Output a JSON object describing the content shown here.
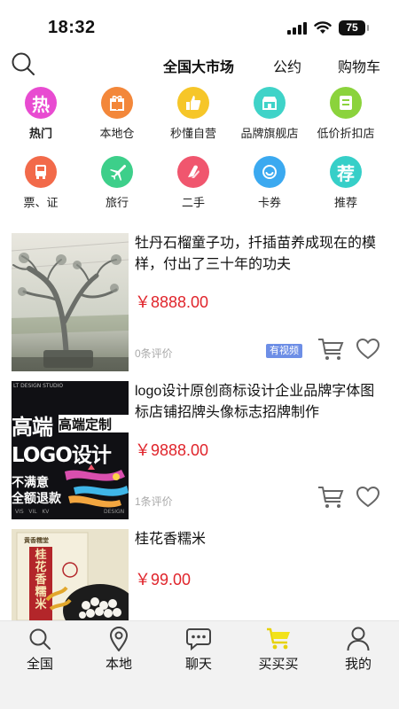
{
  "status_bar": {
    "time": "18:32",
    "battery": "75"
  },
  "top_nav": {
    "tabs": [
      {
        "label": "全国大市场",
        "active": true
      },
      {
        "label": "公约",
        "active": false
      },
      {
        "label": "购物车",
        "active": false
      }
    ]
  },
  "categories": [
    {
      "label": "热门",
      "icon": "hot-icon",
      "glyph": "热",
      "color": "#e84bd1",
      "selected": true
    },
    {
      "label": "本地仓",
      "icon": "gift-icon",
      "glyph": "",
      "color": "#f3873a",
      "selected": false
    },
    {
      "label": "秒懂自营",
      "icon": "thumbs-up-icon",
      "glyph": "",
      "color": "#f6c629",
      "selected": false
    },
    {
      "label": "品牌旗舰店",
      "icon": "store-icon",
      "glyph": "",
      "color": "#3fd3c8",
      "selected": false
    },
    {
      "label": "低价折扣店",
      "icon": "discount-store-icon",
      "glyph": "",
      "color": "#8bd33c",
      "selected": false
    },
    {
      "label": "票、证",
      "icon": "bus-ticket-icon",
      "glyph": "",
      "color": "#f26a4a",
      "selected": false
    },
    {
      "label": "旅行",
      "icon": "airplane-icon",
      "glyph": "",
      "color": "#3dcf8a",
      "selected": false
    },
    {
      "label": "二手",
      "icon": "second-hand-icon",
      "glyph": "",
      "color": "#f0566e",
      "selected": false
    },
    {
      "label": "卡券",
      "icon": "coupon-icon",
      "glyph": "",
      "color": "#3ba9f0",
      "selected": false
    },
    {
      "label": "推荐",
      "icon": "recommend-icon",
      "glyph": "荐",
      "color": "#36cfc8",
      "selected": false
    }
  ],
  "products": [
    {
      "title": "牡丹石榴童子功，扦插苗养成现在的模样，付出了三十年的功夫",
      "price": "￥8888.00",
      "reviews": "0条评价",
      "video_badge": "有视频",
      "image": "bonsai-tree-photo"
    },
    {
      "title": "logo设计原创商标设计企业品牌字体图标店铺招牌头像标志招牌制作",
      "price": "￥9888.00",
      "reviews": "1条评价",
      "image": "logo-design-ad",
      "image_text": {
        "studio": "LT DESIGN STUDIO",
        "line1_a": "高端",
        "line1_b": "高端定制",
        "line2": "LOGO设计",
        "line3": "不满意",
        "line4": "全额退款",
        "foot": "VIS   VIL   KV",
        "foot_right": "DESIGN"
      }
    },
    {
      "title": "桂花香糯米",
      "price": "￥99.00",
      "image": "glutinous-rice-bag",
      "image_text": {
        "bag_label": "桂花香糯米",
        "brand": "黄香糯堂"
      }
    }
  ],
  "tab_bar": {
    "items": [
      {
        "label": "全国",
        "icon": "search-icon",
        "active": false
      },
      {
        "label": "本地",
        "icon": "location-pin-icon",
        "active": false
      },
      {
        "label": "聊天",
        "icon": "chat-bubble-icon",
        "active": false
      },
      {
        "label": "买买买",
        "icon": "shopping-cart-icon",
        "active": true
      },
      {
        "label": "我的",
        "icon": "user-icon",
        "active": false
      }
    ]
  }
}
